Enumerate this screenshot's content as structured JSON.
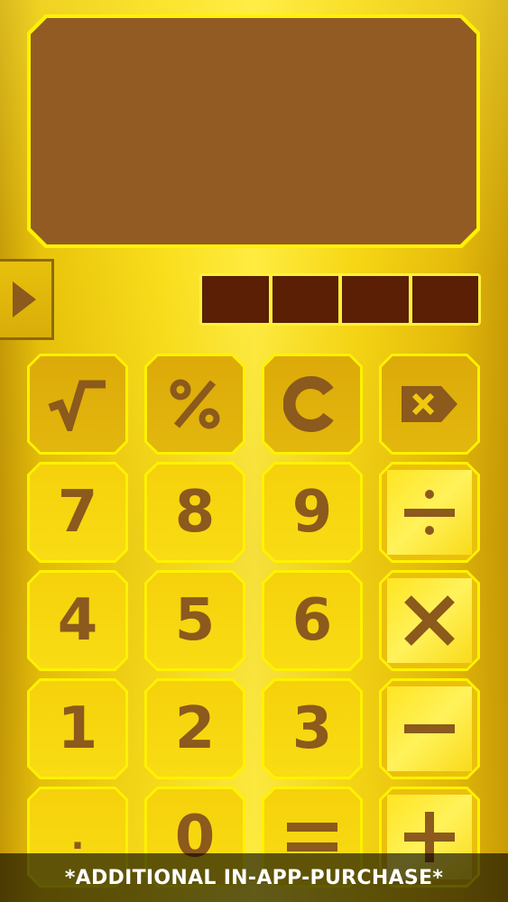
{
  "display": {
    "value": ""
  },
  "memory_slots": 4,
  "keys": {
    "digits": {
      "seven": "7",
      "eight": "8",
      "nine": "9",
      "four": "4",
      "five": "5",
      "six": "6",
      "one": "1",
      "two": "2",
      "three": "3",
      "zero": "0",
      "decimal": "."
    },
    "functions": {
      "sqrt_icon": "square-root-icon",
      "percent_icon": "percent-icon",
      "clear_icon": "clear-c-icon",
      "backspace_icon": "backspace-icon"
    },
    "operators": {
      "divide_icon": "divide-icon",
      "multiply_icon": "multiply-icon",
      "minus_icon": "minus-icon",
      "plus_icon": "plus-icon",
      "equals_icon": "equals-icon"
    }
  },
  "side_toggle_icon": "play-triangle-icon",
  "footer": {
    "text": "*ADDITIONAL IN-APP-PURCHASE*"
  },
  "colors": {
    "display_bg": "#935b24",
    "display_border": "#fff200",
    "memory_cell": "#5a1f05",
    "key_label": "#8b5a1c",
    "gold": "#f5d10c"
  }
}
